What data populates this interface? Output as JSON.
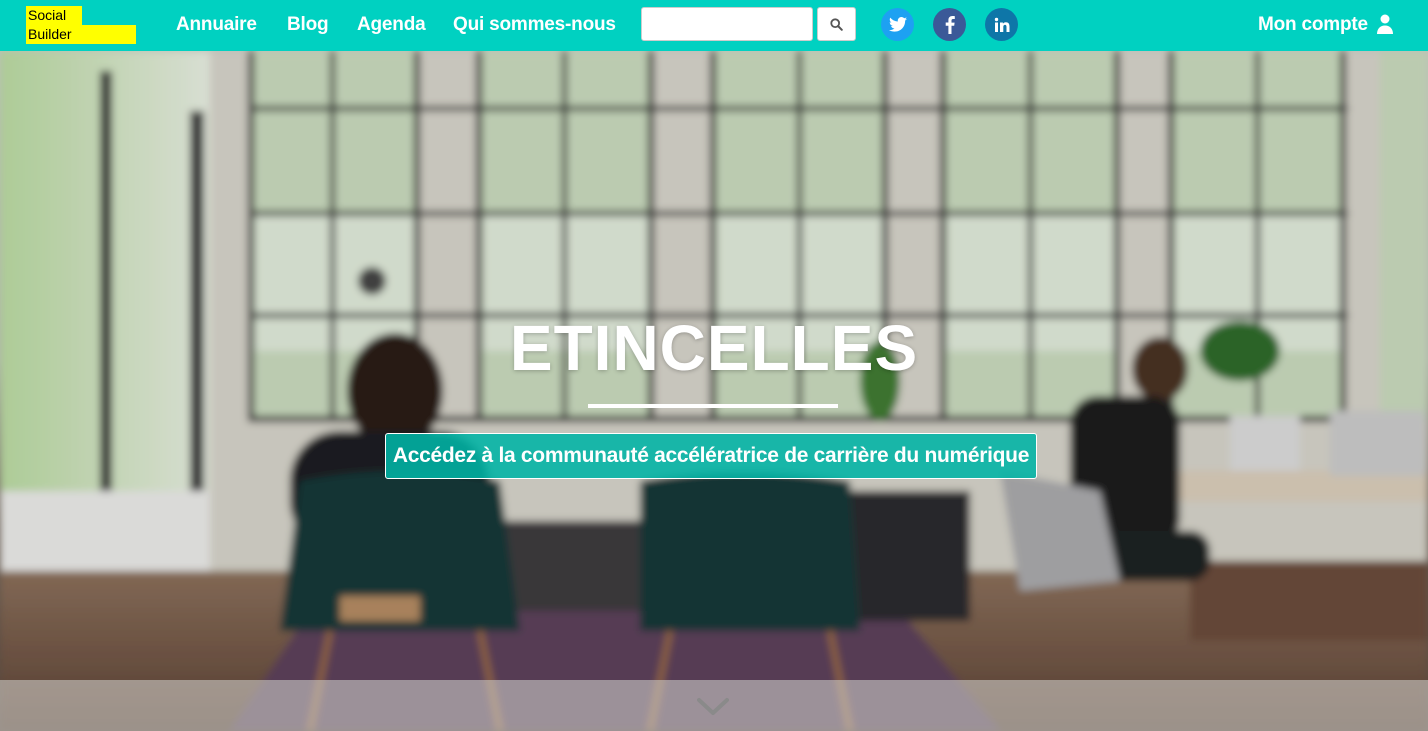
{
  "brand": {
    "line1": "Social",
    "line2": "Builder"
  },
  "nav": {
    "items": [
      {
        "label": "Annuaire"
      },
      {
        "label": "Blog"
      },
      {
        "label": "Agenda"
      },
      {
        "label": "Qui sommes-nous"
      }
    ],
    "search": {
      "placeholder": "",
      "value": "",
      "button_icon": "search-icon"
    },
    "social": [
      {
        "icon": "twitter-icon",
        "color": "#1da1f2"
      },
      {
        "icon": "facebook-icon",
        "color": "#3b5998"
      },
      {
        "icon": "linkedin-icon",
        "color": "#0e76a8"
      }
    ],
    "account_label": "Mon compte",
    "account_icon": "user-icon"
  },
  "hero": {
    "title": "ETINCELLES",
    "tagline": "Accédez à la communauté accélératrice de carrière du numérique",
    "scroll_icon": "chevron-down-icon"
  },
  "colors": {
    "nav_bg": "#00d1c1",
    "logo_bg": "#ffff00",
    "tagline_bg": "#00b4a5"
  }
}
